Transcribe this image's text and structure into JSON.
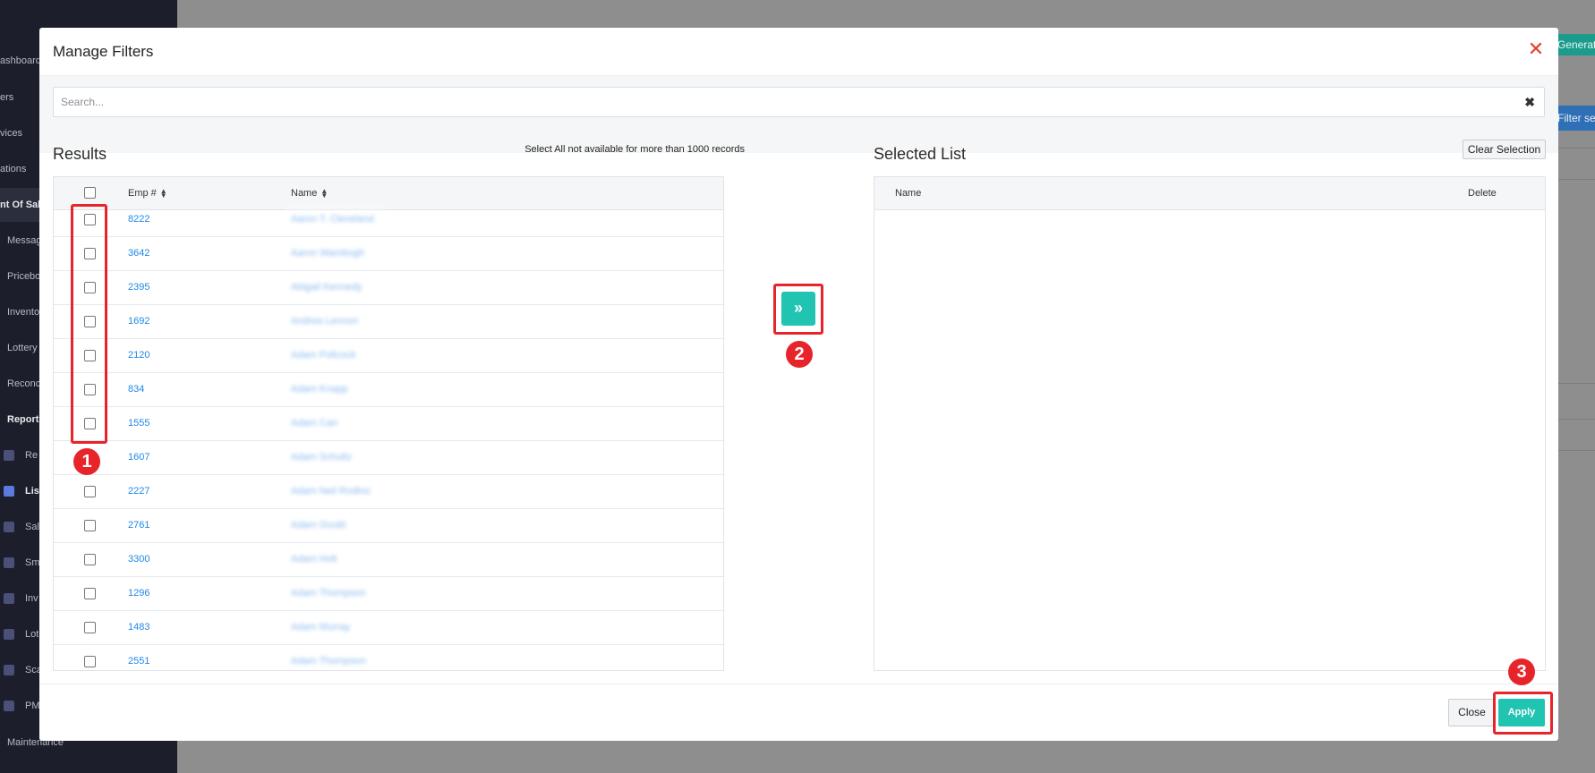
{
  "background": {
    "sidebar_items": [
      {
        "label": "ashboard"
      },
      {
        "label": "ers"
      },
      {
        "label": "vices"
      },
      {
        "label": "ations"
      },
      {
        "label": "nt Of Sal"
      },
      {
        "label": "Messag"
      },
      {
        "label": "Pricebo"
      },
      {
        "label": "Invento"
      },
      {
        "label": "Lottery"
      },
      {
        "label": "Reconc"
      },
      {
        "label": "Reports"
      },
      {
        "label": "Re"
      },
      {
        "label": "Lis"
      },
      {
        "label": "Sal"
      },
      {
        "label": "Sm"
      },
      {
        "label": "Inv"
      },
      {
        "label": "Lot"
      },
      {
        "label": "Sca"
      },
      {
        "label": "PM"
      },
      {
        "label": "Maintenance"
      }
    ],
    "generate_btn": "Generate",
    "filter_btn": "Filter sele"
  },
  "modal": {
    "title": "Manage Filters",
    "search": {
      "placeholder": "Search...",
      "value": ""
    },
    "results": {
      "title": "Results",
      "note": "Select All not available for more than 1000 records",
      "columns": [
        "Emp #",
        "Name"
      ],
      "rows": [
        {
          "emp": "8222",
          "name": "Aaron T. Cleveland"
        },
        {
          "emp": "3642",
          "name": "Aaron Wambogh"
        },
        {
          "emp": "2395",
          "name": "Abigail Kennedy"
        },
        {
          "emp": "1692",
          "name": "Andrea Lennon"
        },
        {
          "emp": "2120",
          "name": "Adam Pollcock"
        },
        {
          "emp": "834",
          "name": "Adam Knapp"
        },
        {
          "emp": "1555",
          "name": "Adam Carr"
        },
        {
          "emp": "1607",
          "name": "Adam Schultz"
        },
        {
          "emp": "2227",
          "name": "Adam Neil Rodino"
        },
        {
          "emp": "2761",
          "name": "Adam Gould"
        },
        {
          "emp": "3300",
          "name": "Adam Holt"
        },
        {
          "emp": "1296",
          "name": "Adam Thompson"
        },
        {
          "emp": "1483",
          "name": "Adam Murray"
        },
        {
          "emp": "2551",
          "name": "Adam Thompson"
        }
      ]
    },
    "move_btn": "»",
    "selected": {
      "title": "Selected List",
      "clear_label": "Clear Selection",
      "columns": [
        "Name",
        "Delete"
      ]
    },
    "footer": {
      "close_label": "Close",
      "apply_label": "Apply"
    }
  },
  "annotations": {
    "badge1": "1",
    "badge2": "2",
    "badge3": "3",
    "color": "#e8242b"
  },
  "colors": {
    "accent": "#20c4b0",
    "link": "#1e88e5",
    "danger": "#e53935"
  }
}
